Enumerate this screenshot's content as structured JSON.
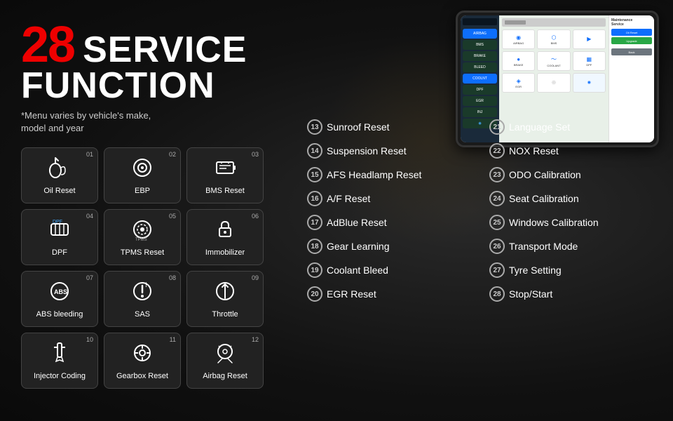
{
  "title": {
    "number": "28",
    "line1": "SERVICE",
    "line2": "FUNCTION",
    "subtitle": "*Menu varies by vehicle's make,\n model and year"
  },
  "icons": [
    {
      "num": "01",
      "label": "Oil Reset",
      "icon": "🛢"
    },
    {
      "num": "02",
      "label": "EBP",
      "icon": "⊙"
    },
    {
      "num": "03",
      "label": "BMS Reset",
      "icon": "🔋"
    },
    {
      "num": "04",
      "label": "DPF",
      "icon": "🔲"
    },
    {
      "num": "05",
      "label": "TPMS Reset",
      "icon": "🔄"
    },
    {
      "num": "06",
      "label": "Immobilizer",
      "icon": "🔑"
    },
    {
      "num": "07",
      "label": "ABS bleeding",
      "icon": "⓪"
    },
    {
      "num": "08",
      "label": "SAS",
      "icon": "⚠"
    },
    {
      "num": "09",
      "label": "Throttle",
      "icon": "↕"
    },
    {
      "num": "10",
      "label": "Injector Coding",
      "icon": "➕"
    },
    {
      "num": "11",
      "label": "Gearbox Reset",
      "icon": "⚙"
    },
    {
      "num": "12",
      "label": "Airbag Reset",
      "icon": "✦"
    }
  ],
  "services_left": [
    {
      "num": "13",
      "name": "Sunroof Reset"
    },
    {
      "num": "14",
      "name": "Suspension Reset"
    },
    {
      "num": "15",
      "name": "AFS Headlamp Reset"
    },
    {
      "num": "16",
      "name": "A/F Reset"
    },
    {
      "num": "17",
      "name": "AdBlue Reset"
    },
    {
      "num": "18",
      "name": "Gear Learning"
    },
    {
      "num": "19",
      "name": "Coolant Bleed"
    },
    {
      "num": "20",
      "name": "EGR Reset"
    }
  ],
  "services_right": [
    {
      "num": "21",
      "name": "Language Set"
    },
    {
      "num": "22",
      "name": "NOX  Reset"
    },
    {
      "num": "23",
      "name": "ODO Calibration"
    },
    {
      "num": "24",
      "name": "Seat Calibration"
    },
    {
      "num": "25",
      "name": "Windows Calibration"
    },
    {
      "num": "26",
      "name": "Transport Mode"
    },
    {
      "num": "27",
      "name": "Tyre Setting"
    },
    {
      "num": "28",
      "name": "Stop/Start"
    }
  ],
  "tablet": {
    "cells": [
      {
        "label": "AIRBAG",
        "icon": "◉"
      },
      {
        "label": "BMS",
        "icon": "⬡"
      },
      {
        "label": "",
        "icon": "▶"
      },
      {
        "label": "BRAKE",
        "icon": "●"
      },
      {
        "label": "COOLANT",
        "icon": "~"
      },
      {
        "label": "DPF",
        "icon": "▦"
      },
      {
        "label": "EGR",
        "icon": "◈"
      },
      {
        "label": "",
        "icon": ""
      },
      {
        "label": "",
        "icon": ""
      }
    ],
    "sidebar": [
      "AIRBAG",
      "BMS",
      "BRAKE",
      "COOLANT"
    ],
    "right_buttons": [
      "Maintenance",
      "Service",
      "Upgrade"
    ]
  }
}
